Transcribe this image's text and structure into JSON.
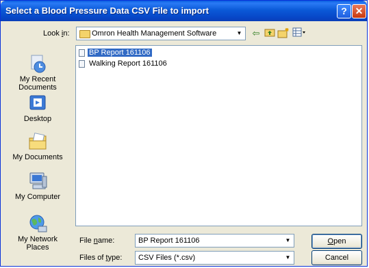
{
  "window": {
    "title": "Select a Blood Pressure Data CSV File to import",
    "help_glyph": "?",
    "close_glyph": "✕"
  },
  "toolbar": {
    "look_in_label_pre": "Look ",
    "look_in_label_key": "i",
    "look_in_label_post": "n:",
    "look_in_value": "Omron Health Management Software",
    "icons": [
      "back-arrow-icon",
      "up-folder-icon",
      "new-folder-icon",
      "view-menu-icon"
    ],
    "back_glyph": "⇦",
    "up_glyph": "⮭",
    "newfolder_glyph": "✳",
    "view_glyph": "▦"
  },
  "places": [
    {
      "label": "My Recent\nDocuments",
      "icon": "recent-documents-icon"
    },
    {
      "label": "Desktop",
      "icon": "desktop-icon"
    },
    {
      "label": "My Documents",
      "icon": "my-documents-icon"
    },
    {
      "label": "My Computer",
      "icon": "my-computer-icon"
    },
    {
      "label": "My Network\nPlaces",
      "icon": "network-places-icon"
    }
  ],
  "files": [
    {
      "name": "BP Report 161106",
      "selected": true
    },
    {
      "name": "Walking Report 161106",
      "selected": false
    }
  ],
  "filename": {
    "label_pre": "File ",
    "label_key": "n",
    "label_post": "ame:",
    "value": "BP Report 161106"
  },
  "filetype": {
    "label_pre": "Files of ",
    "label_key": "t",
    "label_post": "ype:",
    "value": "CSV Files (*.csv)"
  },
  "buttons": {
    "open_key": "O",
    "open_rest": "pen",
    "cancel": "Cancel"
  },
  "colors": {
    "titlebar": "#0b5ad8",
    "selection": "#316ac5",
    "dialog_bg": "#ece9d8"
  }
}
